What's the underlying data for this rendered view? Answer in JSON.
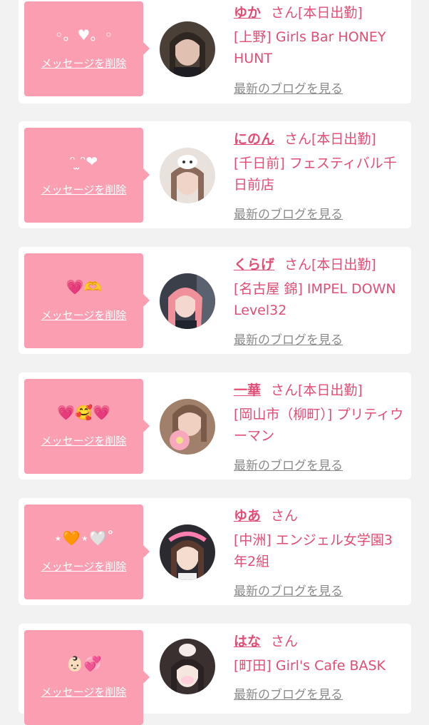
{
  "cards": [
    {
      "delete_label": "メッセージを削除",
      "emoji": "◦。♥。◦",
      "name": "ゆか",
      "suffix": "さん[本日出勤]",
      "shop": "[上野] Girls Bar HONEY HUNT",
      "blog_label": "最新のブログを見る",
      "avatar_colors": [
        "#4a4038",
        "#d8b8a8"
      ]
    },
    {
      "delete_label": "メッセージを削除",
      "emoji": "ᵔ ̫ᵔ❤",
      "name": "にのん",
      "suffix": "さん[本日出勤]",
      "shop": "[千日前] フェスティバル千日前店",
      "blog_label": "最新のブログを見る",
      "avatar_colors": [
        "#e9e2dc",
        "#b89888"
      ]
    },
    {
      "delete_label": "メッセージを削除",
      "emoji": "💗🫶",
      "name": "くらげ",
      "suffix": "さん[本日出勤]",
      "shop": "[名古屋 錦] IMPEL DOWN Level32",
      "blog_label": "最新のブログを見る",
      "avatar_colors": [
        "#3a3f4a",
        "#f2a0a8"
      ]
    },
    {
      "delete_label": "メッセージを削除",
      "emoji": "💗🥰💗",
      "name": "一華",
      "suffix": "さん[本日出勤]",
      "shop": "[岡山市（柳町）] プリティウーマン",
      "blog_label": "最新のブログを見る",
      "avatar_colors": [
        "#7a5a48",
        "#f0b0c0"
      ]
    },
    {
      "delete_label": "メッセージを削除",
      "emoji": "⋆🧡⋆🤍˚",
      "name": "ゆあ",
      "suffix": "さん",
      "shop": "[中洲] エンジェル女学園3年2組",
      "blog_label": "最新のブログを見る",
      "avatar_colors": [
        "#2a2a30",
        "#ff7fb0"
      ]
    },
    {
      "delete_label": "メッセージを削除",
      "emoji": "👶🏻💞",
      "name": "はな",
      "suffix": "さん",
      "shop": "[町田] Girl's Cafe BASK",
      "blog_label": "最新のブログを見る",
      "avatar_colors": [
        "#3a3030",
        "#f4ece8"
      ]
    }
  ]
}
